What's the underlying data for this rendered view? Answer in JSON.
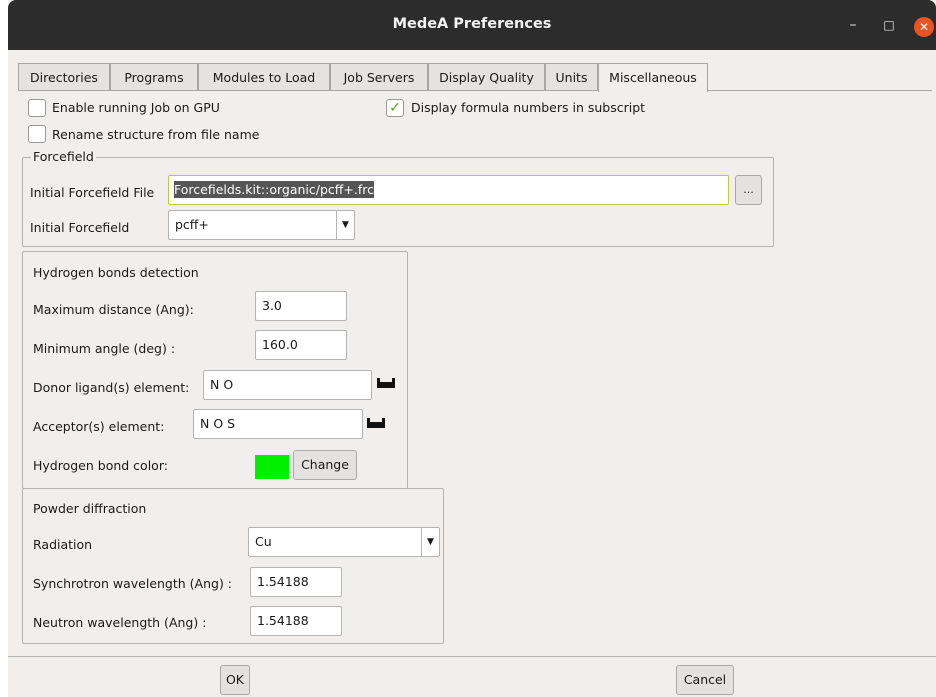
{
  "window": {
    "title": "MedeA Preferences"
  },
  "window_controls": {
    "minimize": "–",
    "maximize": "□",
    "close": "✕"
  },
  "tabs": [
    {
      "label": "Directories"
    },
    {
      "label": "Programs"
    },
    {
      "label": "Modules to Load"
    },
    {
      "label": "Job Servers"
    },
    {
      "label": "Display Quality"
    },
    {
      "label": "Units"
    },
    {
      "label": "Miscellaneous",
      "active": true
    }
  ],
  "options": {
    "gpu_label": "Enable running Job on GPU",
    "gpu_checked": false,
    "subscript_label": "Display formula numbers in subscript",
    "subscript_checked": true,
    "subscript_mark": "✓",
    "rename_label": "Rename structure from file name",
    "rename_checked": false
  },
  "forcefield": {
    "legend": "Forcefield",
    "file_label": "Initial Forcefield File",
    "file_value": "Forcefields.kit::organic/pcff+.frc",
    "browse_label": "...",
    "ff_label": "Initial Forcefield",
    "ff_value": "pcff+"
  },
  "hbond": {
    "legend": "Hydrogen bonds detection",
    "max_dist_label": "Maximum distance (Ang):",
    "max_dist_value": "3.0",
    "min_angle_label": "Minimum angle (deg) :",
    "min_angle_value": "160.0",
    "donor_label": "Donor ligand(s) element:",
    "donor_value": "N O",
    "acceptor_label": "Acceptor(s) element:",
    "acceptor_value": "N O S",
    "color_label": "Hydrogen bond color:",
    "color_value": "#00ee00",
    "change_label": "Change"
  },
  "powder": {
    "legend": "Powder diffraction",
    "radiation_label": "Radiation",
    "radiation_value": "Cu",
    "sync_label": "Synchrotron wavelength (Ang) :",
    "sync_value": "1.54188",
    "neutron_label": "Neutron wavelength (Ang) :",
    "neutron_value": "1.54188"
  },
  "buttons": {
    "ok": "OK",
    "cancel": "Cancel"
  },
  "icons": {
    "element_picker": "periodic-table-icon",
    "dropdown": "dropdown-arrow-icon"
  },
  "colors": {
    "titlebar": "#2c2c2c",
    "close": "#e95420",
    "hbond_color": "#00ee00",
    "focus_border": "#b8c94b"
  }
}
